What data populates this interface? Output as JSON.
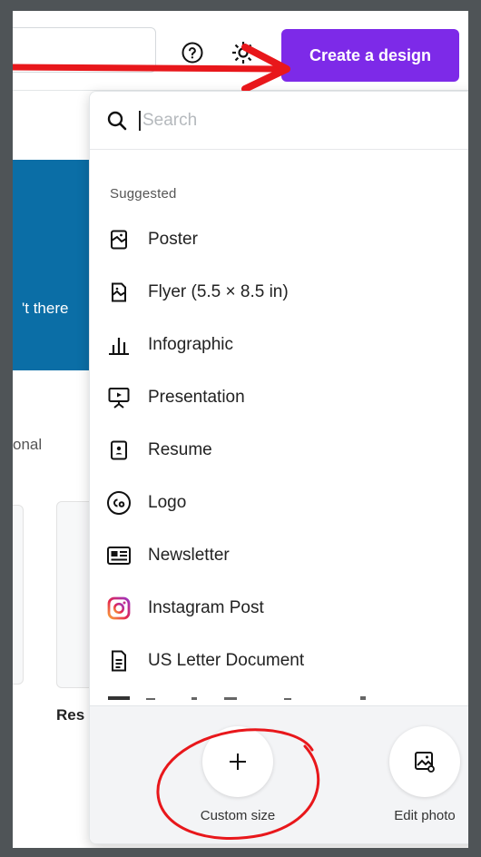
{
  "header": {
    "create_button_label": "Create a design",
    "help_icon": "help-circle-icon",
    "settings_icon": "gear-icon"
  },
  "background": {
    "hero_snippet": "'t there",
    "tab_snippet": "onal",
    "card_label": "Res"
  },
  "dropdown": {
    "search_placeholder": "Search",
    "section_label": "Suggested",
    "items": [
      {
        "label": "Poster",
        "icon": "poster-icon"
      },
      {
        "label": "Flyer (5.5 × 8.5 in)",
        "icon": "flyer-icon"
      },
      {
        "label": "Infographic",
        "icon": "bar-chart-icon"
      },
      {
        "label": "Presentation",
        "icon": "presentation-icon"
      },
      {
        "label": "Resume",
        "icon": "resume-icon"
      },
      {
        "label": "Logo",
        "icon": "logo-co-icon"
      },
      {
        "label": "Newsletter",
        "icon": "newsletter-icon"
      },
      {
        "label": "Instagram Post",
        "icon": "instagram-icon"
      },
      {
        "label": "US Letter Document",
        "icon": "document-icon"
      }
    ],
    "actions": [
      {
        "label": "Custom size",
        "icon": "plus-icon"
      },
      {
        "label": "Edit photo",
        "icon": "image-edit-icon"
      }
    ]
  },
  "colors": {
    "accent": "#7d2ae8",
    "annotation": "#e8171b",
    "banner": "#0b6ea6"
  }
}
